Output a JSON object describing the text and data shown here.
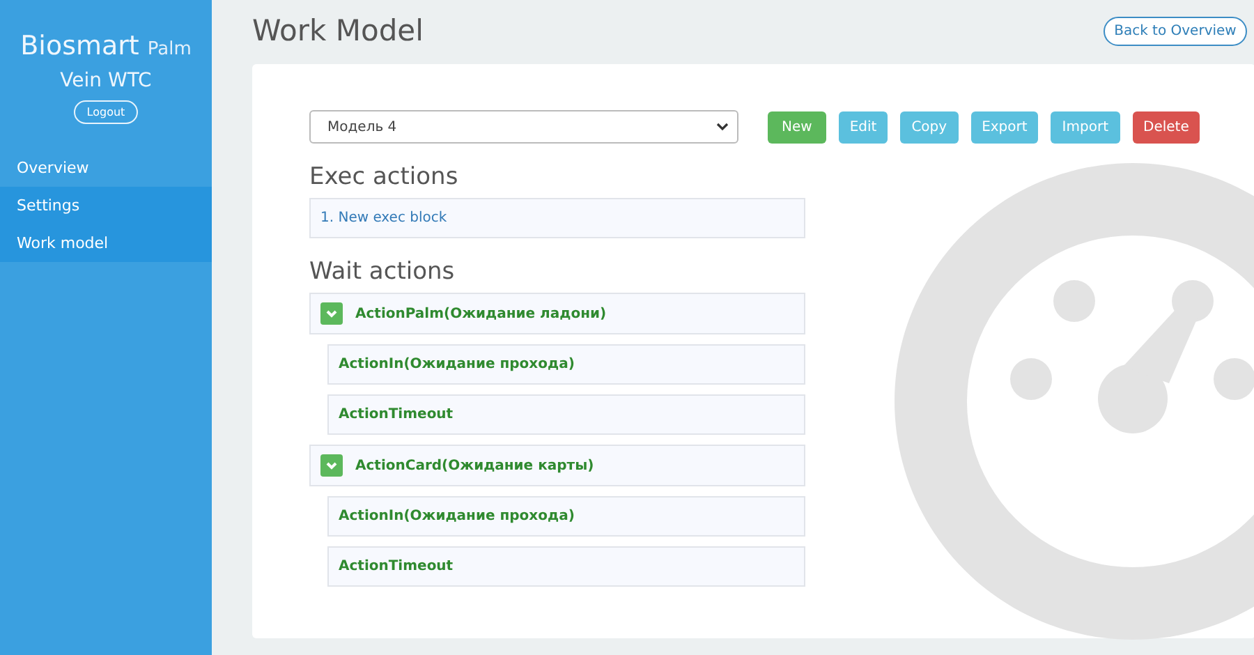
{
  "sidebar": {
    "brand": "Biosmart",
    "brand_suffix": "Palm",
    "brand_line2": "Vein WTC",
    "logout": "Logout",
    "items": [
      {
        "label": "Overview",
        "selected": false
      },
      {
        "label": "Settings",
        "selected": true
      },
      {
        "label": "Work model",
        "selected": true
      }
    ]
  },
  "page": {
    "title": "Work Model",
    "back_button": "Back to Overview"
  },
  "model_select": {
    "value": "Модель 4"
  },
  "buttons": [
    {
      "label": "New",
      "kind": "success"
    },
    {
      "label": "Edit",
      "kind": "info"
    },
    {
      "label": "Copy",
      "kind": "info"
    },
    {
      "label": "Export",
      "kind": "info"
    },
    {
      "label": "Import",
      "kind": "info"
    },
    {
      "label": "Delete",
      "kind": "danger"
    }
  ],
  "exec_actions": {
    "heading": "Exec actions",
    "items": [
      "1. New exec block"
    ]
  },
  "wait_actions": {
    "heading": "Wait actions",
    "items": [
      {
        "label": "ActionPalm(Ожидание ладони)",
        "expanded": true,
        "children": [
          {
            "label": "ActionIn(Ожидание прохода)"
          },
          {
            "label": "ActionTimeout"
          }
        ]
      },
      {
        "label": "ActionCard(Ожидание карты)",
        "expanded": true,
        "children": [
          {
            "label": "ActionIn(Ожидание прохода)"
          },
          {
            "label": "ActionTimeout"
          }
        ]
      }
    ]
  }
}
